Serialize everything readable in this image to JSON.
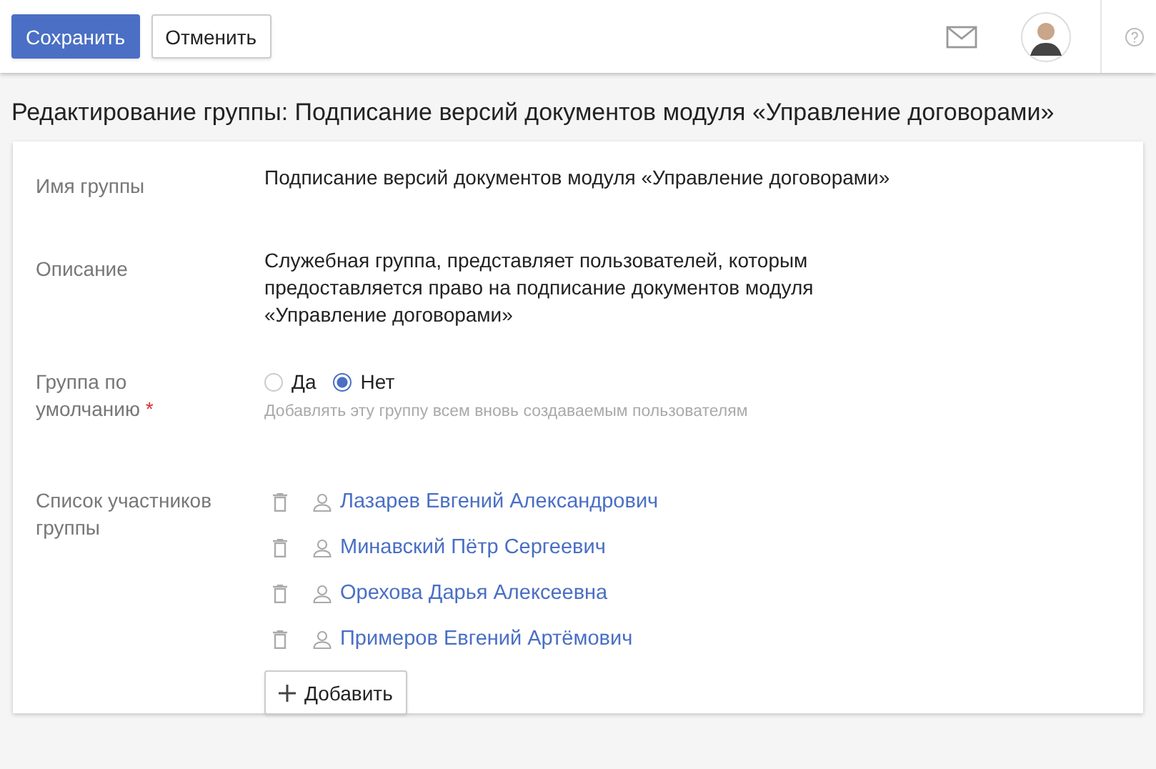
{
  "toolbar": {
    "save_button": "Сохранить",
    "cancel_button": "Отменить"
  },
  "page_title": "Редактирование группы: Подписание версий документов модуля «Управление договорами»",
  "form": {
    "name": {
      "label": "Имя группы",
      "value": "Подписание версий документов модуля «Управление договорами»"
    },
    "description": {
      "label": "Описание",
      "value": "Служебная группа, представляет пользователей, которым предоставляется право на подписание документов модуля «Управление договорами»"
    },
    "default_group": {
      "label": "Группа по умолчанию",
      "required_mark": "*",
      "options": [
        {
          "label": "Да",
          "selected": false
        },
        {
          "label": "Нет",
          "selected": true
        }
      ],
      "hint": "Добавлять эту группу всем вновь создаваемым пользователям"
    },
    "members": {
      "label": "Список участников группы",
      "items": [
        "Лазарев Евгений Александрович",
        "Минавский Пётр Сергеевич",
        "Орехова Дарья Алексеевна",
        "Примеров Евгений Артёмович"
      ],
      "add_button": "Добавить"
    }
  }
}
